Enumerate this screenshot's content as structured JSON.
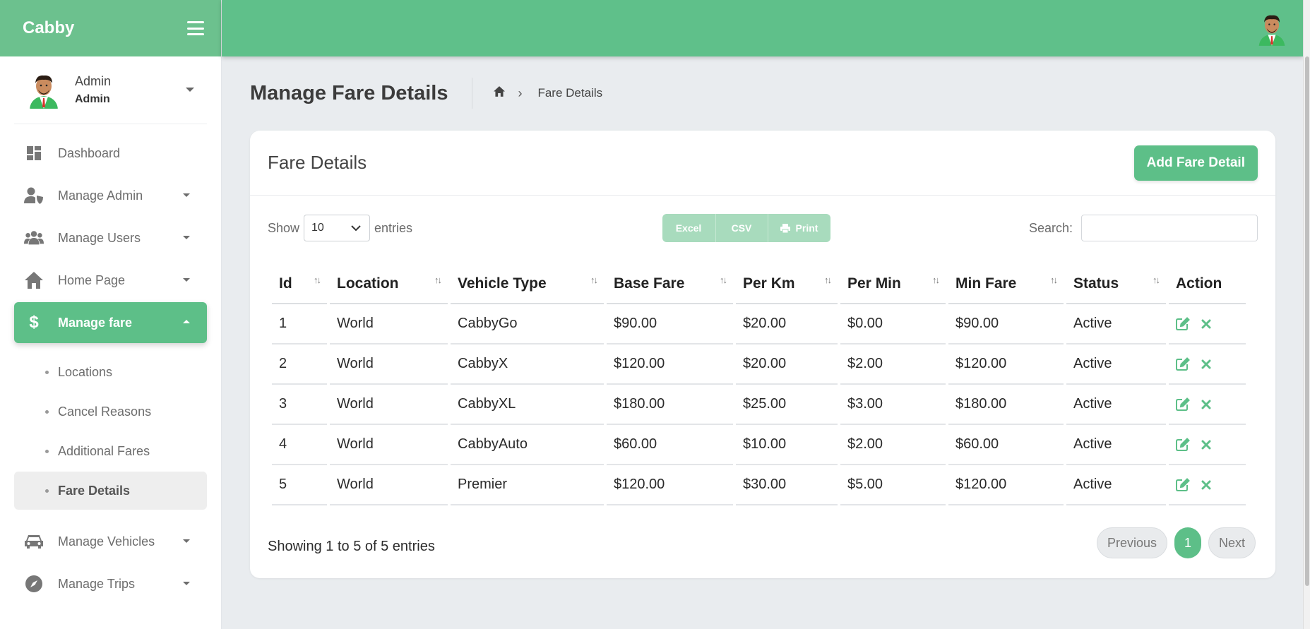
{
  "brand": {
    "name": "Cabby"
  },
  "user": {
    "name": "Admin",
    "role": "Admin"
  },
  "sidebar": {
    "items": [
      {
        "label": "Dashboard",
        "icon": "dashboard-icon"
      },
      {
        "label": "Manage Admin",
        "icon": "admin-shield-icon"
      },
      {
        "label": "Manage Users",
        "icon": "users-icon"
      },
      {
        "label": "Home Page",
        "icon": "home-icon"
      },
      {
        "label": "Manage fare",
        "icon": "dollar-icon"
      }
    ],
    "sub_items": [
      {
        "label": "Locations"
      },
      {
        "label": "Cancel Reasons"
      },
      {
        "label": "Additional Fares"
      },
      {
        "label": "Fare Details"
      }
    ],
    "bottom_items": [
      {
        "label": "Manage Vehicles",
        "icon": "car-icon"
      },
      {
        "label": "Manage Trips",
        "icon": "compass-icon"
      }
    ]
  },
  "page": {
    "title": "Manage Fare Details",
    "breadcrumb": {
      "current": "Fare Details"
    }
  },
  "card": {
    "title": "Fare Details",
    "add_button": "Add Fare Detail"
  },
  "toolbar": {
    "show_label": "Show",
    "entries_label": "entries",
    "page_length": "10",
    "excel": "Excel",
    "csv": "CSV",
    "print": "Print",
    "search_label": "Search:",
    "search_value": ""
  },
  "table": {
    "columns": [
      "Id",
      "Location",
      "Vehicle Type",
      "Base Fare",
      "Per Km",
      "Per Min",
      "Min Fare",
      "Status",
      "Action"
    ],
    "rows": [
      [
        "1",
        "World",
        "CabbyGo",
        "$90.00",
        "$20.00",
        "$0.00",
        "$90.00",
        "Active"
      ],
      [
        "2",
        "World",
        "CabbyX",
        "$120.00",
        "$20.00",
        "$2.00",
        "$120.00",
        "Active"
      ],
      [
        "3",
        "World",
        "CabbyXL",
        "$180.00",
        "$25.00",
        "$3.00",
        "$180.00",
        "Active"
      ],
      [
        "4",
        "World",
        "CabbyAuto",
        "$60.00",
        "$10.00",
        "$2.00",
        "$60.00",
        "Active"
      ],
      [
        "5",
        "World",
        "Premier",
        "$120.00",
        "$30.00",
        "$5.00",
        "$120.00",
        "Active"
      ]
    ]
  },
  "footer": {
    "info": "Showing 1 to 5 of 5 entries",
    "previous": "Previous",
    "page": "1",
    "next": "Next"
  },
  "colors": {
    "accent": "#5dbf88",
    "topbar": "#5fc08a"
  }
}
